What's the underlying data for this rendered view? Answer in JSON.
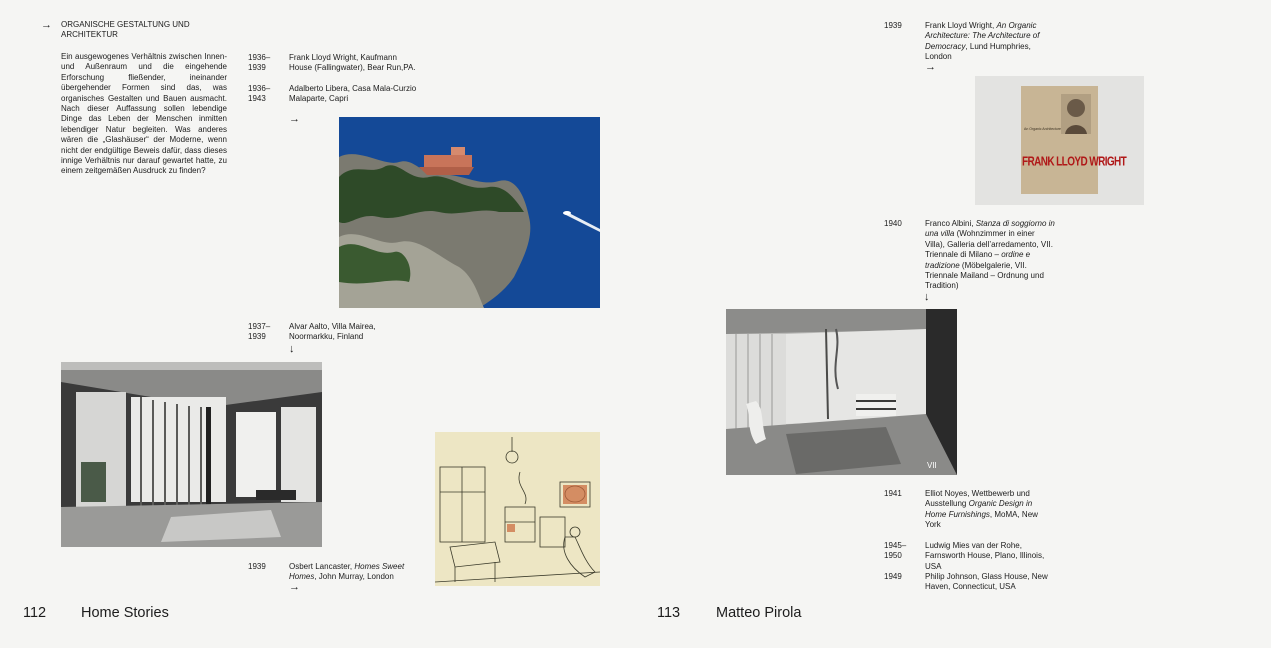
{
  "left_page": {
    "section_title": "ORGANISCHE GESTALTUNG UND ARCHITEKTUR",
    "intro": "Ein ausgewogenes Verhältnis zwischen Innen- und Außenraum und die eingehende Erforschung fließender, ineinander übergehender Formen sind das, was organisches Gestalten und Bauen ausmacht. Nach dieser Auffassung sollen lebendige Dinge das Leben der Menschen inmitten lebendiger Natur begleiten. Was anderes wären die „Glashäuser“ der Moderne, wenn nicht der endgültige Beweis dafür, dass dieses innige Verhältnis nur darauf gewartet hatte, zu einem zeitgemäßen Ausdruck zu finden?",
    "entries": [
      {
        "year": "1936–\n1939",
        "text": "Frank Lloyd Wright, Kaufmann House (Fallingwater), Bear Run,PA."
      },
      {
        "year": "1936–\n1943",
        "text": "Adalberto Libera, Casa Mala-Curzio Malaparte, Capri"
      },
      {
        "year": "1937–\n1939",
        "text": "Alvar Aalto, Villa Mairea, Noormarkku, Finland"
      },
      {
        "year": "1939",
        "text_plain": "Osbert Lancaster, ",
        "text_italic": "Homes Sweet Homes",
        "text_rest": ", John Murray, London"
      }
    ],
    "folio_number": "112",
    "folio_title": "Home Stories"
  },
  "right_page": {
    "entries": [
      {
        "year": "1939",
        "text_plain": "Frank Lloyd Wright, ",
        "text_italic": "An Organic Architecture: The Architecture of Democracy",
        "text_rest": ", Lund Humphries, London"
      },
      {
        "year": "1940",
        "p1": "Franco Albini, ",
        "i1": "Stanza di soggiorno in una villa",
        "p2": " (Wohnzimmer in einer Villa), Galleria dell’arredamento, VII. Triennale di Milano – ",
        "i2": "ordine e tradizione",
        "p3": " (Möbelgalerie, VII. Triennale Mailand – Ordnung und Tradition)"
      },
      {
        "year": "1941",
        "text_plain": "Elliot Noyes, Wettbewerb und Ausstellung ",
        "text_italic": "Organic Design in Home Furnishings",
        "text_rest": ", MoMA, New York"
      },
      {
        "year": "1945–\n1950",
        "text": "Ludwig Mies van der Rohe, Farnsworth House, Plano, Illinois, USA"
      },
      {
        "year": "1949",
        "text": "Philip Johnson, Glass House, New Haven, Connecticut, USA"
      }
    ],
    "book_cover": {
      "title": "FRANK LLOYD WRIGHT",
      "subtitle": "An Organic Architecture"
    },
    "photo_caption": "VII",
    "folio_number": "113",
    "folio_title": "Matteo Pirola"
  },
  "arrows": {
    "right": "→",
    "down": "↓"
  },
  "colors": {
    "background": "#f5f5f3",
    "text": "#1c1c1c",
    "sea": "#123f8a",
    "book_cover": "#c8b595",
    "book_red": "#b01818",
    "sketch_bg": "#ede6c4"
  }
}
